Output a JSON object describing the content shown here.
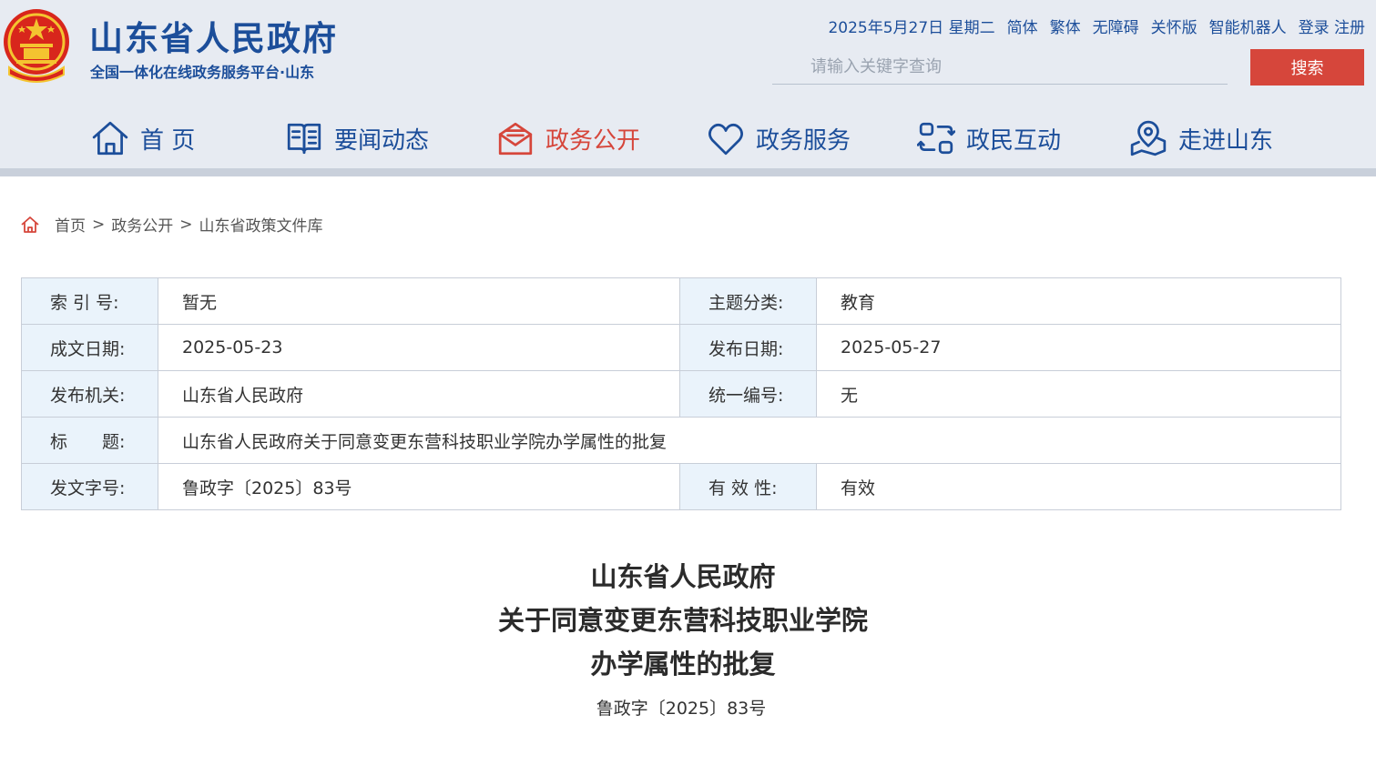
{
  "header": {
    "title": "山东省人民政府",
    "subtitle": "全国一体化在线政务服务平台·山东",
    "date": "2025年5月27日 星期二",
    "links": [
      "简体",
      "繁体",
      "无障碍",
      "关怀版",
      "智能机器人",
      "登录 注册"
    ],
    "search": {
      "placeholder": "请输入关键字查询",
      "button": "搜索"
    }
  },
  "nav": [
    {
      "label": "首 页",
      "icon": "home-icon",
      "active": false
    },
    {
      "label": "要闻动态",
      "icon": "book-icon",
      "active": false
    },
    {
      "label": "政务公开",
      "icon": "mail-icon",
      "active": true
    },
    {
      "label": "政务服务",
      "icon": "heart-icon",
      "active": false
    },
    {
      "label": "政民互动",
      "icon": "interaction-icon",
      "active": false
    },
    {
      "label": "走进山东",
      "icon": "location-icon",
      "active": false
    }
  ],
  "breadcrumb": {
    "items": [
      "首页",
      "政务公开",
      "山东省政策文件库"
    ],
    "separator": ">"
  },
  "meta": {
    "index_label": "索 引 号:",
    "index_value": "暂无",
    "category_label": "主题分类:",
    "category_value": "教育",
    "written_label": "成文日期:",
    "written_value": "2025-05-23",
    "published_label": "发布日期:",
    "published_value": "2025-05-27",
    "issuer_label": "发布机关:",
    "issuer_value": "山东省人民政府",
    "code_label": "统一编号:",
    "code_value": "无",
    "title_label": "标　　题:",
    "title_value": "山东省人民政府关于同意变更东营科技职业学院办学属性的批复",
    "docno_label": "发文字号:",
    "docno_value": "鲁政字〔2025〕83号",
    "validity_label": "有 效 性:",
    "validity_value": "有效"
  },
  "document": {
    "title_lines": [
      "山东省人民政府",
      "关于同意变更东营科技职业学院",
      "办学属性的批复"
    ],
    "number": "鲁政字〔2025〕83号"
  },
  "colors": {
    "brand": "#1c4e9a",
    "accent": "#d6463b",
    "header_bg": "#e7ebf2",
    "label_bg": "#eaf3fb"
  }
}
